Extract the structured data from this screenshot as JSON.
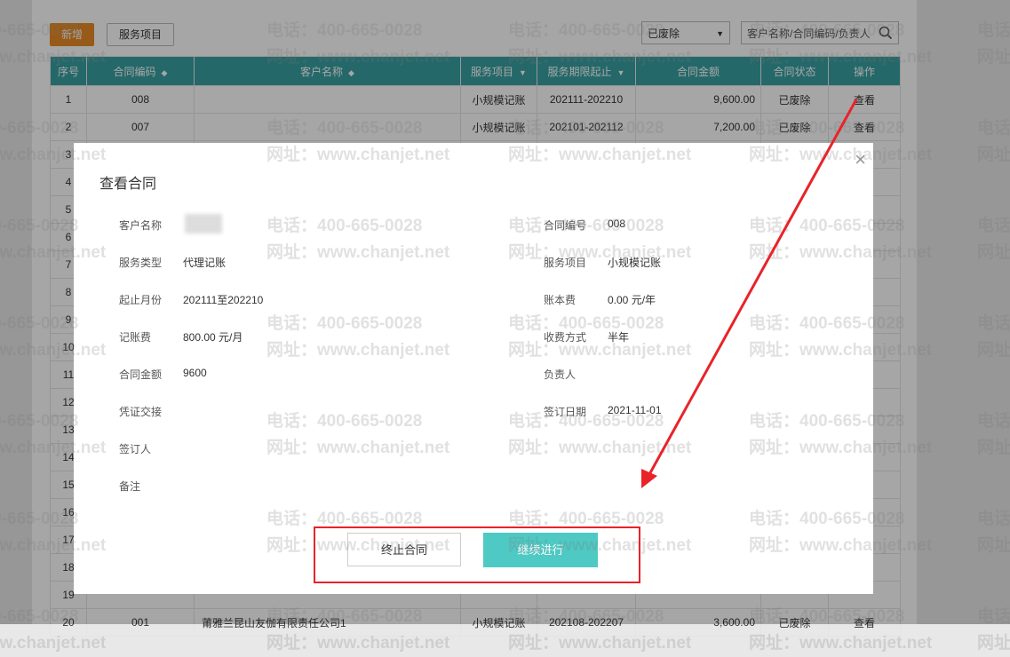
{
  "toolbar": {
    "add_label": "新增",
    "service_label": "服务项目",
    "status_select": "已废除",
    "search_placeholder": "客户名称/合同编码/负责人"
  },
  "table": {
    "headers": [
      "序号",
      "合同编码",
      "客户名称",
      "服务项目",
      "服务期限起止",
      "合同金额",
      "合同状态",
      "操作"
    ],
    "rows": [
      {
        "no": "1",
        "code": "008",
        "name": "",
        "service": "小规模记账",
        "period": "202111-202210",
        "amount": "9,600.00",
        "status": "已废除",
        "action": "查看"
      },
      {
        "no": "2",
        "code": "007",
        "name": "",
        "service": "小规模记账",
        "period": "202101-202112",
        "amount": "7,200.00",
        "status": "已废除",
        "action": "查看"
      },
      {
        "no": "3"
      },
      {
        "no": "4"
      },
      {
        "no": "5"
      },
      {
        "no": "6"
      },
      {
        "no": "7"
      },
      {
        "no": "8"
      },
      {
        "no": "9"
      },
      {
        "no": "10"
      },
      {
        "no": "11"
      },
      {
        "no": "12"
      },
      {
        "no": "13"
      },
      {
        "no": "14"
      },
      {
        "no": "15"
      },
      {
        "no": "16"
      },
      {
        "no": "17"
      },
      {
        "no": "18"
      },
      {
        "no": "19"
      },
      {
        "no": "20",
        "code": "001",
        "name": "莆雅兰昆山友伽有限责任公司1",
        "service": "小规模记账",
        "period": "202108-202207",
        "amount": "3,600.00",
        "status": "已废除",
        "action": "查看"
      }
    ]
  },
  "watermark": {
    "phone": "电话：400-665-0028",
    "site": "网址：www.chanjet.net",
    "phone_short": "400-665-0028",
    "site_short": "www.chanjet.net"
  },
  "modal": {
    "title": "查看合同",
    "close_icon": "×",
    "left": [
      {
        "label": "客户名称",
        "value": ""
      },
      {
        "label": "服务类型",
        "value": "代理记账"
      },
      {
        "label": "起止月份",
        "value": "202111至202210"
      },
      {
        "label": "记账费",
        "value": "800.00 元/月"
      },
      {
        "label": "合同金额",
        "value": "9600"
      },
      {
        "label": "凭证交接",
        "value": ""
      },
      {
        "label": "签订人",
        "value": ""
      },
      {
        "label": "备注",
        "value": ""
      }
    ],
    "right": [
      {
        "label": "合同编号",
        "value": "008"
      },
      {
        "label": "服务项目",
        "value": "小规模记账"
      },
      {
        "label": "账本费",
        "value": "0.00 元/年"
      },
      {
        "label": "收费方式",
        "value": "半年"
      },
      {
        "label": "负责人",
        "value": ""
      },
      {
        "label": "签订日期",
        "value": "2021-11-01"
      }
    ],
    "terminate_label": "终止合同",
    "continue_label": "继续进行"
  },
  "annotation": {
    "color": "#e8232a"
  },
  "colors": {
    "header": "#3aa0a2",
    "accent": "#4fc9c4",
    "add": "#e98b25"
  }
}
